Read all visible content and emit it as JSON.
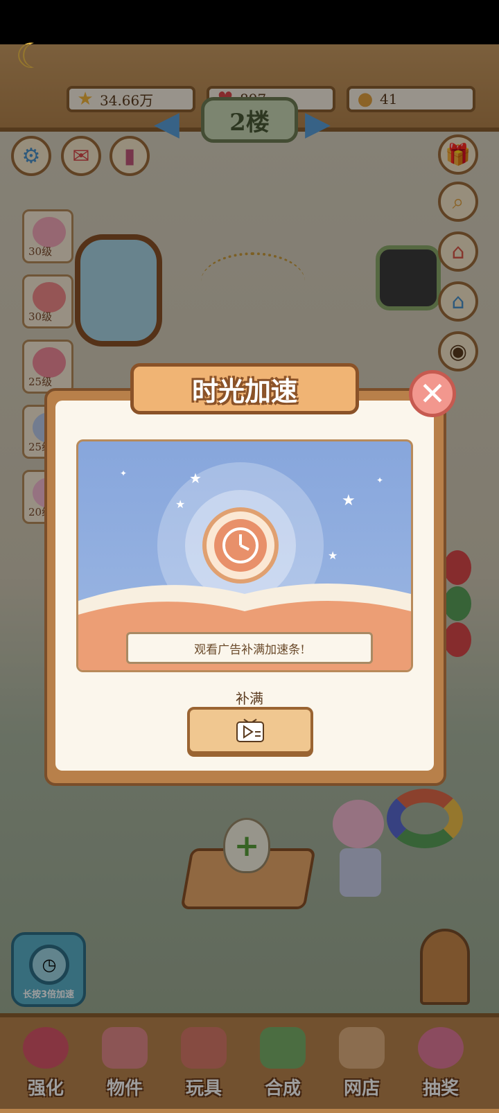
{
  "resources": [
    {
      "icon": "star-icon",
      "value": "34.66万"
    },
    {
      "icon": "heart-icon",
      "value": "897"
    },
    {
      "icon": "coin-icon",
      "value": "41"
    }
  ],
  "floor": {
    "label": "2楼"
  },
  "characters": [
    {
      "level": "30级"
    },
    {
      "level": "30级"
    },
    {
      "level": "25级"
    },
    {
      "level": "25级"
    },
    {
      "level": "20级"
    }
  ],
  "speedup_button": {
    "label": "长按3倍加速"
  },
  "bottom_tabs": [
    {
      "label": "强化",
      "icon": "lollipop-icon",
      "color": "#d9566a"
    },
    {
      "label": "物件",
      "icon": "piano-icon",
      "color": "#e28a8a"
    },
    {
      "label": "玩具",
      "icon": "house-toy-icon",
      "color": "#d97a6a"
    },
    {
      "label": "合成",
      "icon": "merge-cards-icon",
      "color": "#7ab06a"
    },
    {
      "label": "网店",
      "icon": "shop-cart-icon",
      "color": "#e0b080"
    },
    {
      "label": "抽奖",
      "icon": "lottery-wheel-icon",
      "color": "#e07a9a"
    }
  ],
  "dialog": {
    "title": "时光加速",
    "caption": "观看广告补满加速条!",
    "fill_label": "补满",
    "watch_icon": "tv-ad-icon"
  },
  "colors": {
    "dialog_bg": "#fbf6ec",
    "title_bg": "#f0b474",
    "button_bg": "#f0c790",
    "close_bg": "#f2978e"
  }
}
